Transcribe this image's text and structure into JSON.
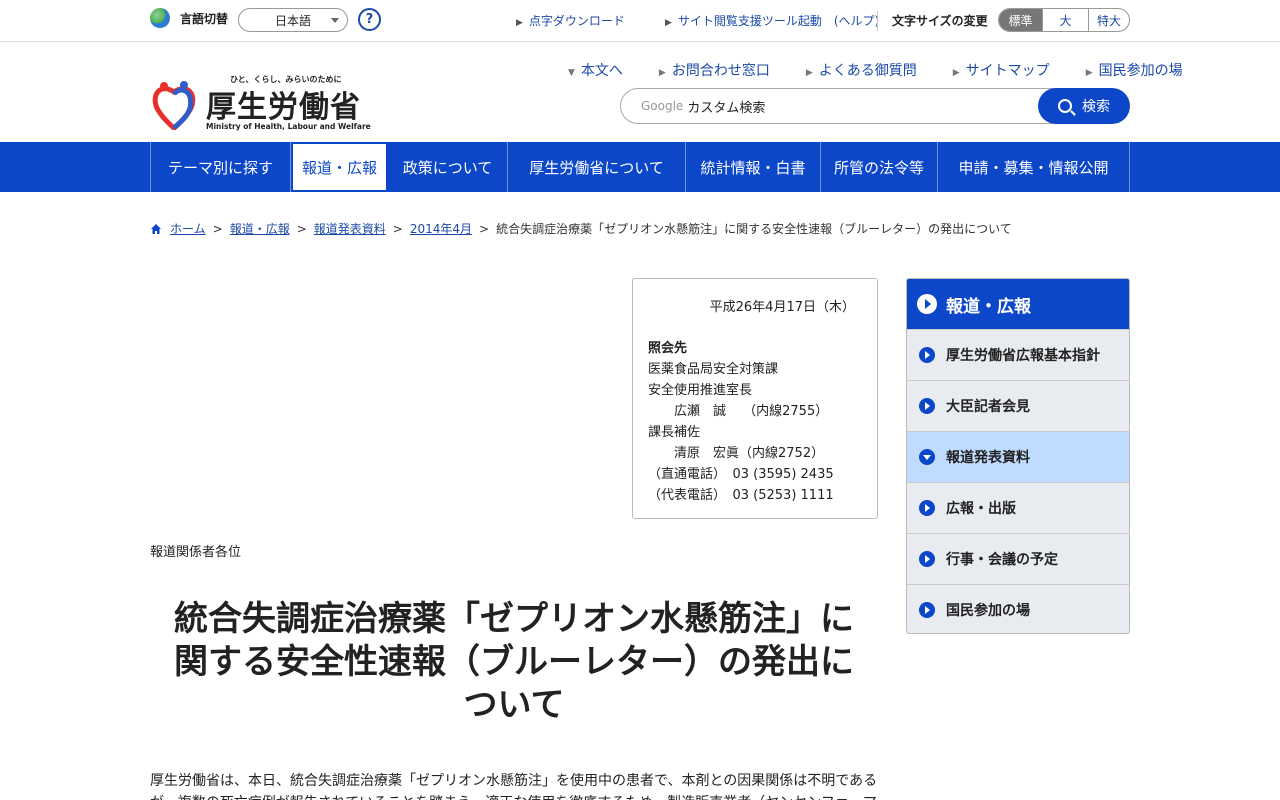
{
  "topbar": {
    "lang_label": "言語切替",
    "lang_value": "日本語",
    "help": "?",
    "links": [
      "点字ダウンロード",
      "サイト閲覧支援ツール起動　(ヘルプ)"
    ],
    "fontsize_label": "文字サイズの変更",
    "fontsize_options": [
      "標準",
      "大",
      "特大"
    ]
  },
  "logo": {
    "tagline": "ひと、くらし、みらいのために",
    "name": "厚生労働省",
    "english": "Ministry of Health, Labour and Welfare"
  },
  "header": {
    "links": [
      "本文へ",
      "お問合わせ窓口",
      "よくある御質問",
      "サイトマップ",
      "国民参加の場"
    ],
    "search_google": "Google",
    "search_placeholder": "カスタム検索",
    "search_button": "検索"
  },
  "gnav": [
    "テーマ別に探す",
    "報道・広報",
    "政策について",
    "厚生労働省について",
    "統計情報・白書",
    "所管の法令等",
    "申請・募集・情報公開"
  ],
  "breadcrumb": {
    "items": [
      "ホーム",
      "報道・広報",
      "報道発表資料",
      "2014年4月"
    ],
    "current": "統合失調症治療薬「ゼプリオン水懸筋注」に関する安全性速報（ブルーレター）の発出について"
  },
  "contact": {
    "date": "平成26年4月17日（木）",
    "heading": "照会先",
    "lines": [
      "医薬食品局安全対策課",
      "安全使用推進室長",
      "　　広瀬　誠　 （内線2755）",
      "課長補佐",
      "　　清原　宏眞（内線2752）",
      "（直通電話）　03 (3595) 2435",
      "（代表電話）　03 (5253) 1111"
    ]
  },
  "main": {
    "addressee": "報道関係者各位",
    "title_lines": [
      "統合失調症治療薬「ゼプリオン水懸筋注」に",
      "関する安全性速報（ブルーレター）の発出に",
      "ついて"
    ],
    "body": "厚生労働省は、本日、統合失調症治療薬「ゼプリオン水懸筋注」を使用中の患者で、本剤との因果関係は不明であるが、複数の死亡症例が報告されていることを踏まえ、適正な使用を徹底するため、製造販売業者（ヤンセンファーマ"
  },
  "sidebar": {
    "heading": "報道・広報",
    "items": [
      "厚生労働省広報基本指針",
      "大臣記者会見",
      "報道発表資料",
      "広報・出版",
      "行事・会議の予定",
      "国民参加の場"
    ],
    "active_index": 2
  },
  "colors": {
    "primary": "#0d47c9",
    "link": "#1b4aa8",
    "active_side": "#bfdbff"
  }
}
